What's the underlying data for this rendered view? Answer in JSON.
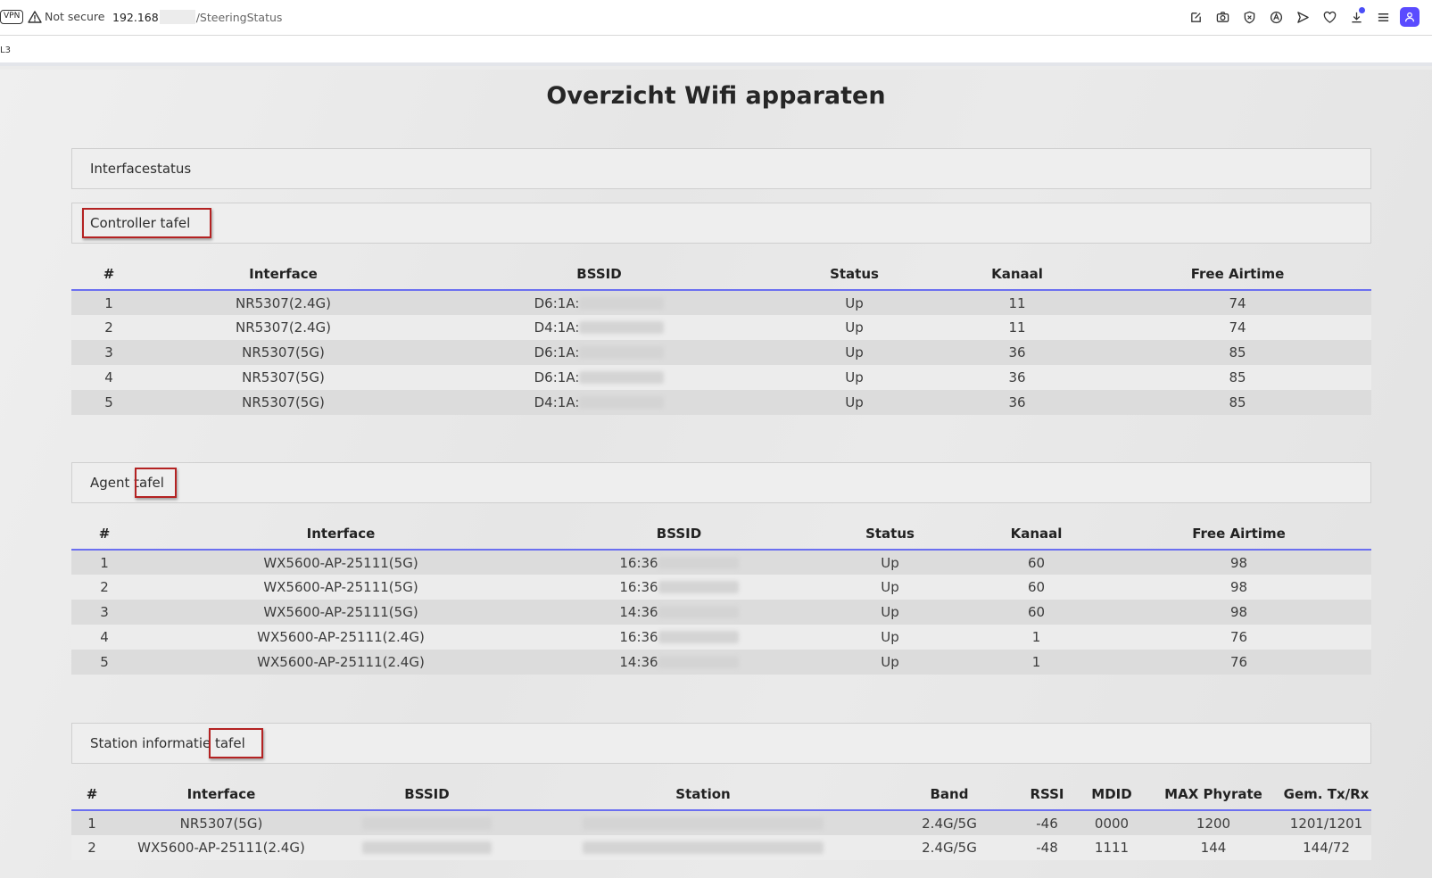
{
  "browser": {
    "vpn_label": "VPN",
    "not_secure": "Not secure",
    "url_ip": "192.168",
    "url_path": "/SteeringStatus",
    "bookmark": "L3",
    "accent_color": "#5a4bff"
  },
  "page": {
    "title": "Overzicht Wifi apparaten"
  },
  "interface_status": {
    "label": "Interfacestatus"
  },
  "controller": {
    "label": "Controller tafel",
    "columns": [
      "#",
      "Interface",
      "BSSID",
      "Status",
      "Kanaal",
      "Free Airtime"
    ],
    "rows": [
      [
        "1",
        "NR5307(2.4G)",
        "D6:1A:",
        "Up",
        "11",
        "74"
      ],
      [
        "2",
        "NR5307(2.4G)",
        "D4:1A:",
        "Up",
        "11",
        "74"
      ],
      [
        "3",
        "NR5307(5G)",
        "D6:1A:",
        "Up",
        "36",
        "85"
      ],
      [
        "4",
        "NR5307(5G)",
        "D6:1A:",
        "Up",
        "36",
        "85"
      ],
      [
        "5",
        "NR5307(5G)",
        "D4:1A:",
        "Up",
        "36",
        "85"
      ]
    ]
  },
  "agent": {
    "label": "Agent tafel",
    "columns": [
      "#",
      "Interface",
      "BSSID",
      "Status",
      "Kanaal",
      "Free Airtime"
    ],
    "rows": [
      [
        "1",
        "WX5600-AP-25111(5G)",
        "16:36",
        "Up",
        "60",
        "98"
      ],
      [
        "2",
        "WX5600-AP-25111(5G)",
        "16:36",
        "Up",
        "60",
        "98"
      ],
      [
        "3",
        "WX5600-AP-25111(5G)",
        "14:36",
        "Up",
        "60",
        "98"
      ],
      [
        "4",
        "WX5600-AP-25111(2.4G)",
        "16:36",
        "Up",
        "1",
        "76"
      ],
      [
        "5",
        "WX5600-AP-25111(2.4G)",
        "14:36",
        "Up",
        "1",
        "76"
      ]
    ]
  },
  "station": {
    "label": "Station informatie tafel",
    "columns": [
      "#",
      "Interface",
      "BSSID",
      "Station",
      "Band",
      "RSSI",
      "MDID",
      "MAX Phyrate",
      "Gem. Tx/Rx"
    ],
    "rows": [
      [
        "1",
        "NR5307(5G)",
        "",
        "",
        "2.4G/5G",
        "-46",
        "0000",
        "1200",
        "1201/1201"
      ],
      [
        "2",
        "WX5600-AP-25111(2.4G)",
        "",
        "",
        "2.4G/5G",
        "-48",
        "1111",
        "144",
        "144/72"
      ]
    ]
  }
}
